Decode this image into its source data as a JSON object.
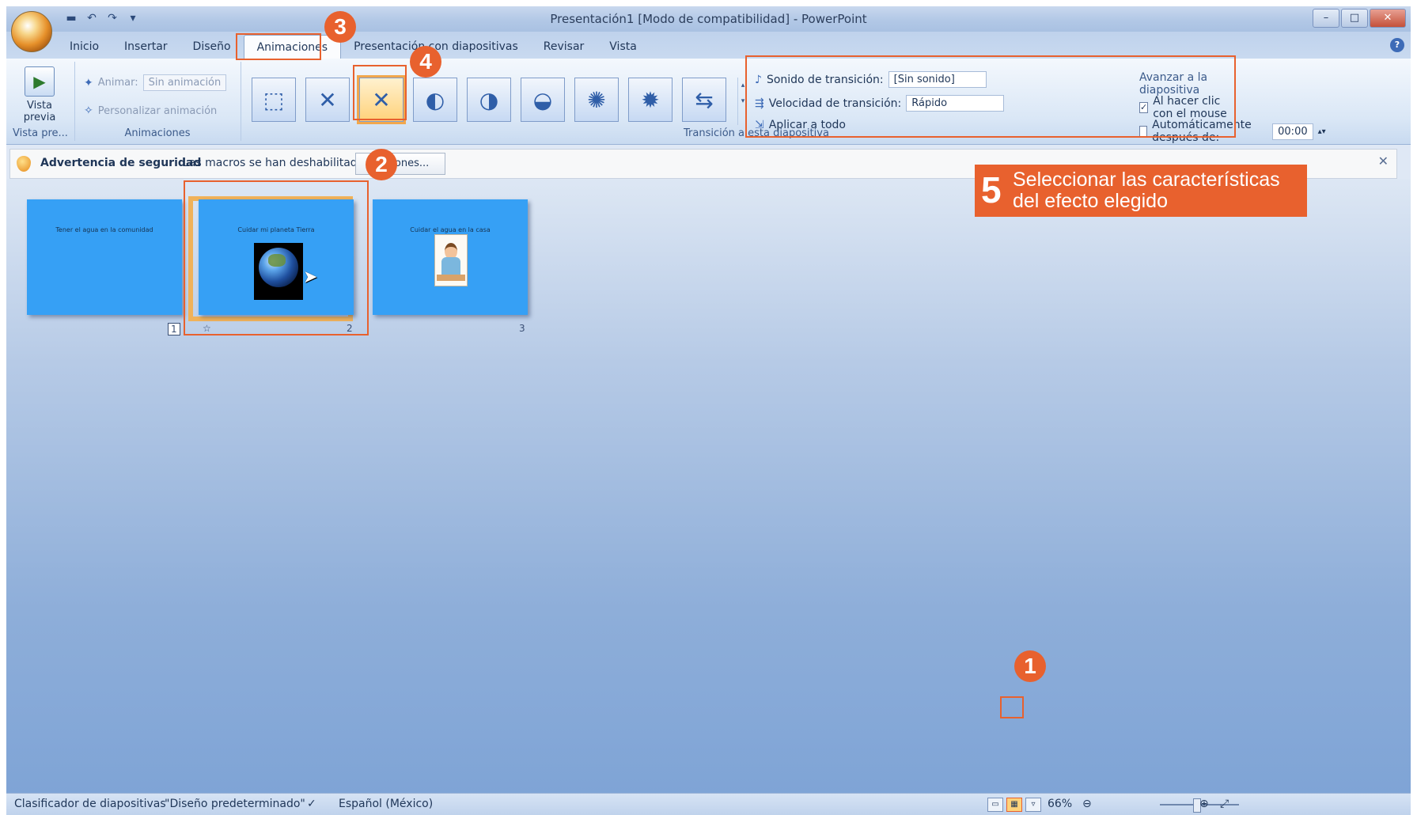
{
  "window": {
    "title": "Presentación1 [Modo de compatibilidad] - PowerPoint"
  },
  "qat": {
    "save_icon": "save-icon",
    "undo_icon": "undo-icon",
    "redo_icon": "redo-icon",
    "more_icon": "dropdown-icon"
  },
  "tabs": [
    {
      "label": "Inicio"
    },
    {
      "label": "Insertar"
    },
    {
      "label": "Diseño"
    },
    {
      "label": "Animaciones",
      "active": true
    },
    {
      "label": "Presentación con diapositivas"
    },
    {
      "label": "Revisar"
    },
    {
      "label": "Vista"
    }
  ],
  "ribbon": {
    "preview": {
      "label": "Vista previa",
      "group": "Vista pre..."
    },
    "animations": {
      "animar_label": "Animar:",
      "animar_value": "Sin animación",
      "personalizar_label": "Personalizar animación",
      "group": "Animaciones"
    },
    "transition_group": "Transición a esta diapositiva",
    "options": {
      "sound_label": "Sonido de transición:",
      "sound_value": "[Sin sonido]",
      "speed_label": "Velocidad de transición:",
      "speed_value": "Rápido",
      "apply_all": "Aplicar a todo",
      "advance_title": "Avanzar a la diapositiva",
      "on_click": "Al hacer clic con el mouse",
      "on_click_checked": true,
      "auto_after": "Automáticamente después de:",
      "auto_value": "00:00"
    }
  },
  "security": {
    "title": "Advertencia de seguridad",
    "message": "Las macros se han deshabilitado.",
    "options_button": "Opciones..."
  },
  "slides": [
    {
      "title": "Tener el agua en la comunidad",
      "number": "1"
    },
    {
      "title": "Cuidar mi planeta Tierra",
      "number": "2"
    },
    {
      "title": "Cuidar el agua en la casa",
      "number": "3"
    }
  ],
  "status": {
    "view": "Clasificador de diapositivas",
    "theme": "\"Diseño predeterminado\"",
    "language": "Español (México)",
    "zoom": "66%"
  },
  "annotations": {
    "b1": "1",
    "b2": "2",
    "b3": "3",
    "b4": "4",
    "callout_num": "5",
    "callout_text": "Seleccionar las características del efecto elegido",
    "accent": "#e8612e"
  }
}
